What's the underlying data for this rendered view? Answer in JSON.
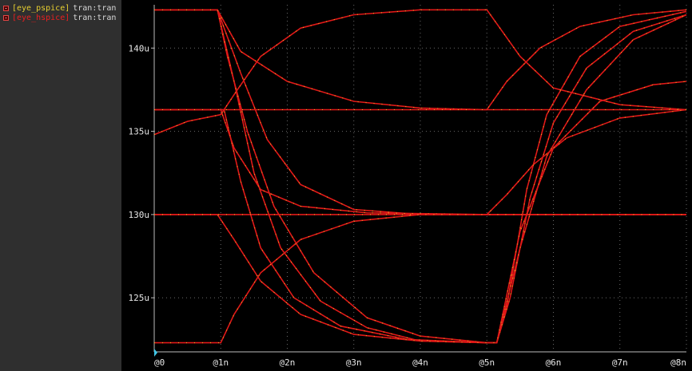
{
  "legend": {
    "items": [
      {
        "name": "[eye_pspice]",
        "kind": "tran:tran",
        "color": "#e8d030"
      },
      {
        "name": "[eye_hspice]",
        "kind": "tran:tran",
        "color": "#e82020"
      }
    ]
  },
  "colors": {
    "background": "#000000",
    "panel": "#2f2f2f",
    "grid": "#6a6a6a",
    "hspice": "#e01818",
    "pspice": "#f0c020",
    "cursor": "#40c8e8"
  },
  "chart_data": {
    "type": "line",
    "x_unit": "ns",
    "xlim": [
      0,
      8
    ],
    "ylim": [
      121.8,
      142.6
    ],
    "grid": true,
    "x_ticks": [
      {
        "v": 0,
        "label": "@0"
      },
      {
        "v": 1,
        "label": "@1n"
      },
      {
        "v": 2,
        "label": "@2n"
      },
      {
        "v": 3,
        "label": "@3n"
      },
      {
        "v": 4,
        "label": "@4n"
      },
      {
        "v": 5,
        "label": "@5n"
      },
      {
        "v": 6,
        "label": "@6n"
      },
      {
        "v": 7,
        "label": "@7n"
      },
      {
        "v": 8,
        "label": "@8n"
      }
    ],
    "y_ticks": [
      {
        "v": 125,
        "label": "125u"
      },
      {
        "v": 130,
        "label": "130u"
      },
      {
        "v": 135,
        "label": "135u"
      },
      {
        "v": 140,
        "label": "140u"
      }
    ],
    "series": [
      {
        "name": "[eye_hspice]",
        "points": [
          [
            0,
            142.3
          ],
          [
            0.95,
            142.3
          ],
          [
            1.3,
            138.5
          ],
          [
            1.7,
            134.5
          ],
          [
            2.2,
            131.8
          ],
          [
            3.0,
            130.3
          ],
          [
            4.0,
            130.0
          ],
          [
            5.0,
            130.0
          ],
          [
            5.3,
            131.2
          ],
          [
            5.7,
            133.0
          ],
          [
            6.2,
            134.6
          ],
          [
            7.0,
            135.8
          ],
          [
            8.0,
            136.3
          ]
        ]
      },
      {
        "name": "[eye_hspice]",
        "points": [
          [
            0,
            142.3
          ],
          [
            0.95,
            142.3
          ],
          [
            1.2,
            138.0
          ],
          [
            1.5,
            132.5
          ],
          [
            1.9,
            128.0
          ],
          [
            2.5,
            124.8
          ],
          [
            3.2,
            123.2
          ],
          [
            4.0,
            122.4
          ],
          [
            5.0,
            122.3
          ],
          [
            5.15,
            122.3
          ],
          [
            5.3,
            124.5
          ],
          [
            5.6,
            131.5
          ],
          [
            5.9,
            136.0
          ],
          [
            6.4,
            139.5
          ],
          [
            7.0,
            141.3
          ],
          [
            8.0,
            142.2
          ]
        ]
      },
      {
        "name": "[eye_hspice]",
        "points": [
          [
            0,
            142.3
          ],
          [
            0.95,
            142.3
          ],
          [
            1.1,
            139.5
          ],
          [
            1.4,
            135.0
          ],
          [
            1.8,
            130.5
          ],
          [
            2.4,
            126.5
          ],
          [
            3.2,
            123.8
          ],
          [
            4.0,
            122.7
          ],
          [
            5.0,
            122.3
          ],
          [
            5.15,
            122.3
          ],
          [
            5.35,
            125.0
          ],
          [
            5.65,
            131.0
          ],
          [
            6.0,
            135.5
          ],
          [
            6.5,
            138.8
          ],
          [
            7.2,
            141.0
          ],
          [
            8.0,
            142.0
          ]
        ]
      },
      {
        "name": "[eye_hspice]",
        "points": [
          [
            0,
            142.3
          ],
          [
            0.95,
            142.3
          ],
          [
            1.3,
            139.8
          ],
          [
            2.0,
            138.0
          ],
          [
            3.0,
            136.8
          ],
          [
            4.0,
            136.4
          ],
          [
            5.0,
            136.3
          ],
          [
            8.0,
            136.3
          ]
        ]
      },
      {
        "name": "[eye_hspice]",
        "points": [
          [
            0,
            136.3
          ],
          [
            1.0,
            136.3
          ],
          [
            1.2,
            134.0
          ],
          [
            1.6,
            131.5
          ],
          [
            2.2,
            130.5
          ],
          [
            3.2,
            130.1
          ],
          [
            5.0,
            130.0
          ],
          [
            8.0,
            130.0
          ]
        ]
      },
      {
        "name": "[eye_hspice]",
        "points": [
          [
            0,
            136.3
          ],
          [
            1.05,
            136.3
          ],
          [
            1.3,
            132.0
          ],
          [
            1.6,
            128.0
          ],
          [
            2.1,
            125.0
          ],
          [
            2.8,
            123.3
          ],
          [
            3.8,
            122.5
          ],
          [
            5.0,
            122.3
          ],
          [
            5.15,
            122.3
          ],
          [
            5.5,
            128.0
          ],
          [
            5.9,
            133.5
          ],
          [
            6.5,
            137.5
          ],
          [
            7.2,
            140.5
          ],
          [
            8.0,
            142.0
          ]
        ]
      },
      {
        "name": "[eye_hspice]",
        "points": [
          [
            0,
            134.8
          ],
          [
            0.5,
            135.6
          ],
          [
            1.0,
            136.0
          ],
          [
            1.25,
            137.5
          ],
          [
            1.6,
            139.5
          ],
          [
            2.2,
            141.2
          ],
          [
            3.0,
            142.0
          ],
          [
            4.0,
            142.3
          ],
          [
            5.0,
            142.3
          ],
          [
            5.5,
            139.5
          ],
          [
            6.0,
            137.6
          ],
          [
            7.0,
            136.6
          ],
          [
            8.0,
            136.3
          ]
        ]
      },
      {
        "name": "[eye_hspice]",
        "points": [
          [
            0,
            136.3
          ],
          [
            5.0,
            136.3
          ],
          [
            5.3,
            138.0
          ],
          [
            5.8,
            140.0
          ],
          [
            6.4,
            141.3
          ],
          [
            7.2,
            142.0
          ],
          [
            8.0,
            142.3
          ]
        ]
      },
      {
        "name": "[eye_hspice]",
        "points": [
          [
            0,
            130.0
          ],
          [
            8.0,
            130.0
          ]
        ]
      },
      {
        "name": "[eye_hspice]",
        "points": [
          [
            0,
            130.0
          ],
          [
            0.95,
            130.0
          ],
          [
            1.2,
            128.5
          ],
          [
            1.6,
            126.0
          ],
          [
            2.2,
            124.0
          ],
          [
            3.0,
            122.8
          ],
          [
            4.0,
            122.4
          ],
          [
            5.0,
            122.3
          ],
          [
            5.15,
            122.3
          ],
          [
            5.5,
            129.0
          ],
          [
            6.0,
            134.0
          ],
          [
            6.7,
            136.8
          ],
          [
            7.5,
            137.8
          ],
          [
            8.0,
            138.0
          ]
        ]
      },
      {
        "name": "[eye_hspice]",
        "points": [
          [
            0,
            122.3
          ],
          [
            1.0,
            122.3
          ],
          [
            1.2,
            124.0
          ],
          [
            1.6,
            126.5
          ],
          [
            2.2,
            128.5
          ],
          [
            3.0,
            129.6
          ],
          [
            4.0,
            130.0
          ],
          [
            5.0,
            130.0
          ],
          [
            8.0,
            130.0
          ]
        ]
      }
    ]
  }
}
